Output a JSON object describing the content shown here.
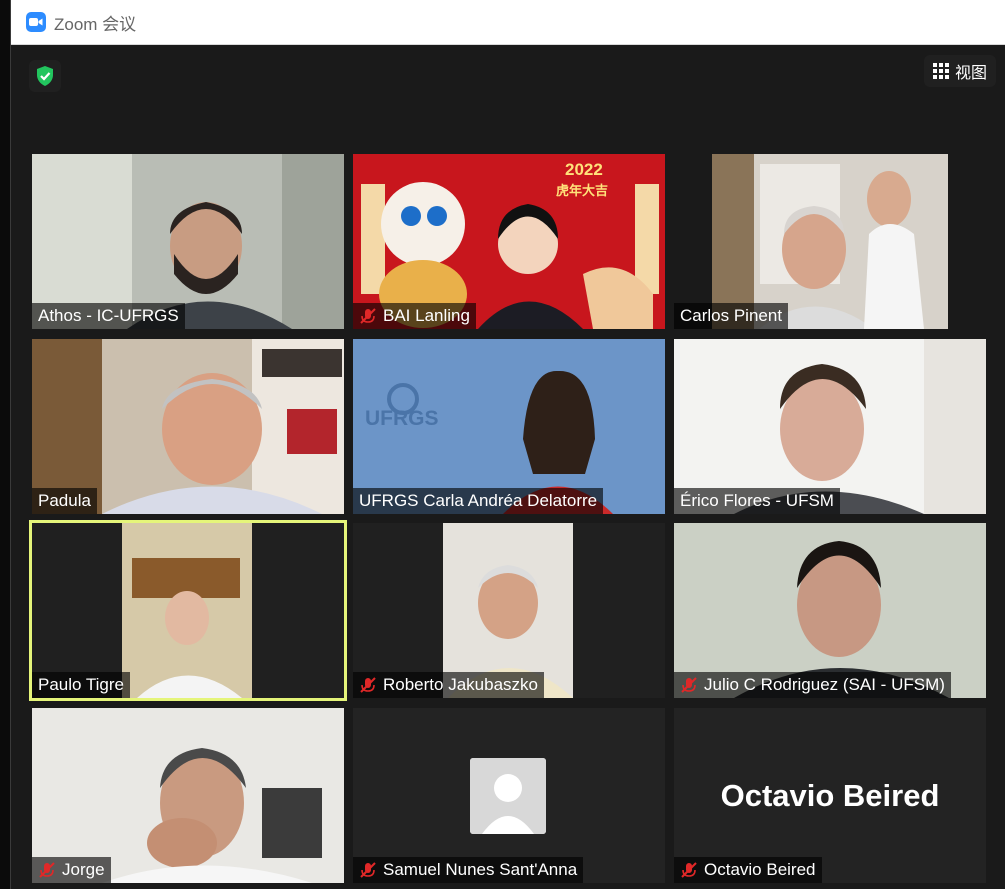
{
  "window": {
    "title": "Zoom 会议",
    "view_label": "视图"
  },
  "participants": [
    {
      "name": "Athos - IC-UFRGS",
      "muted": false
    },
    {
      "name": "BAI Lanling",
      "muted": true
    },
    {
      "name": "Carlos Pinent",
      "muted": false
    },
    {
      "name": "Padula",
      "muted": false
    },
    {
      "name": "UFRGS  Carla Andréa Delatorre",
      "muted": false
    },
    {
      "name": "Érico Flores - UFSM",
      "muted": false
    },
    {
      "name": "Paulo Tigre",
      "muted": false,
      "active_speaker": true
    },
    {
      "name": "Roberto Jakubaszko",
      "muted": true
    },
    {
      "name": "Julio C Rodriguez (SAI - UFSM)",
      "muted": true
    },
    {
      "name": "Jorge",
      "muted": true
    },
    {
      "name": "Samuel Nunes Sant'Anna",
      "muted": true
    },
    {
      "name": "Octavio Beired",
      "muted": true,
      "video_off_display_name": "Octavio Beired"
    }
  ],
  "overlays": {
    "new_year_year": "2022",
    "new_year_text": "虎年大吉",
    "ufrgs_logo_text": "UFRGS"
  },
  "colors": {
    "accent": "#2d8cff",
    "active_border": "#e5f57a",
    "muted_red": "#e02828",
    "shield_green": "#22c55e"
  },
  "icons": [
    "zoom-app-icon",
    "encryption-shield-icon",
    "grid-view-icon",
    "muted-mic-icon"
  ]
}
